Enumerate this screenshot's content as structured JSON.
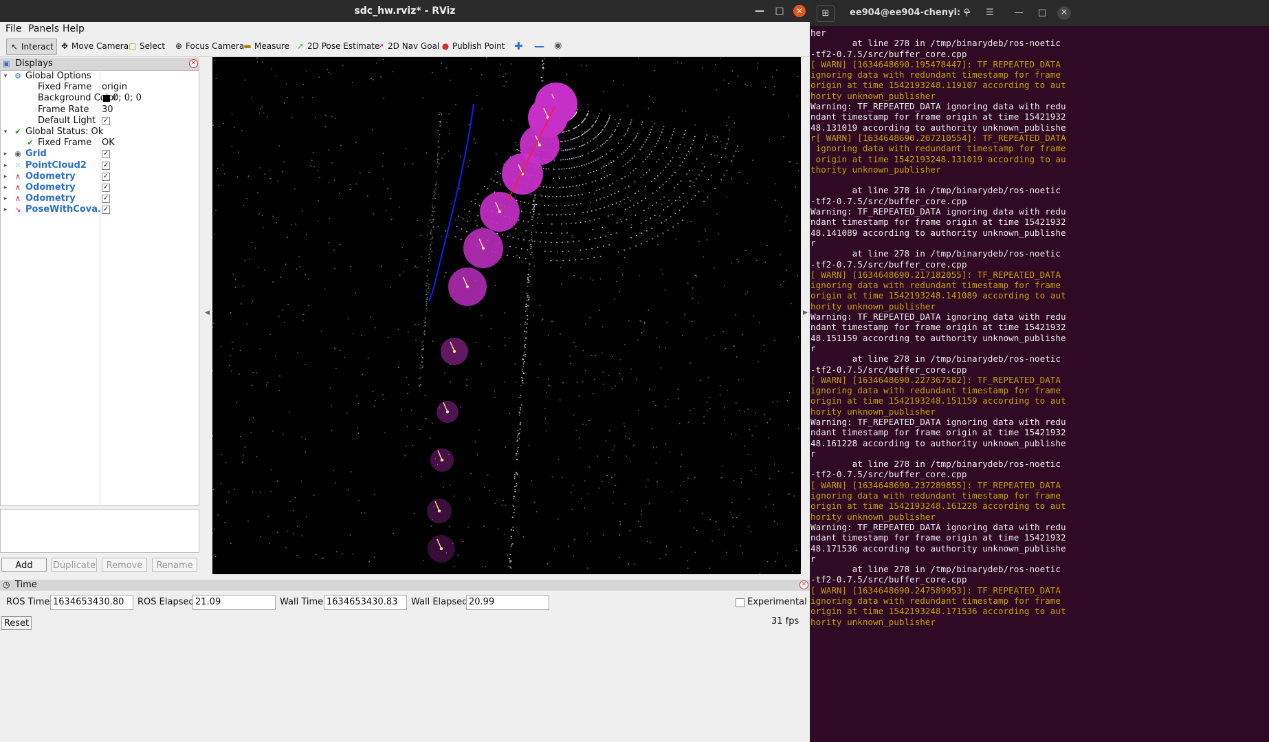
{
  "rviz": {
    "window_title": "sdc_hw.rviz* - RViz",
    "menu": [
      "File",
      "Panels",
      "Help"
    ],
    "tools": [
      "Interact",
      "Move Camera",
      "Select",
      "Focus Camera",
      "Measure",
      "2D Pose Estimate",
      "2D Nav Goal",
      "Publish Point"
    ],
    "displays_title": "Displays",
    "tree": [
      {
        "label": "Global Options",
        "value": "",
        "level": 0,
        "expanded": true,
        "icon": "gear-icon"
      },
      {
        "label": "Fixed Frame",
        "value": "origin",
        "level": 1
      },
      {
        "label": "Background Color",
        "value": "0; 0; 0",
        "level": 1,
        "swatch": "#000000"
      },
      {
        "label": "Frame Rate",
        "value": "30",
        "level": 1
      },
      {
        "label": "Default Light",
        "value": "",
        "level": 1,
        "checked": true
      },
      {
        "label": "Global Status: Ok",
        "value": "",
        "level": 0,
        "expanded": true,
        "icon": "check-icon"
      },
      {
        "label": "Fixed Frame",
        "value": "OK",
        "level": 1,
        "icon": "check-icon"
      },
      {
        "label": "Grid",
        "value": "",
        "level": 0,
        "display": true,
        "checked": true,
        "icon": "grid-icon"
      },
      {
        "label": "PointCloud2",
        "value": "",
        "level": 0,
        "display": true,
        "checked": true,
        "icon": "pointcloud-icon"
      },
      {
        "label": "Odometry",
        "value": "",
        "level": 0,
        "display": true,
        "checked": true,
        "icon": "odometry-icon"
      },
      {
        "label": "Odometry",
        "value": "",
        "level": 0,
        "display": true,
        "checked": true,
        "icon": "odometry-icon"
      },
      {
        "label": "Odometry",
        "value": "",
        "level": 0,
        "display": true,
        "checked": true,
        "icon": "odometry-icon"
      },
      {
        "label": "PoseWithCova...",
        "value": "",
        "level": 0,
        "display": true,
        "checked": true,
        "icon": "pose-icon"
      }
    ],
    "panel_buttons": [
      "Add",
      "Duplicate",
      "Remove",
      "Rename"
    ],
    "time": {
      "title": "Time",
      "ros_time_label": "ROS Time:",
      "ros_time": "1634653430.80",
      "ros_elapsed_label": "ROS Elapsed:",
      "ros_elapsed": "21.09",
      "wall_time_label": "Wall Time:",
      "wall_time": "1634653430.83",
      "wall_elapsed_label": "Wall Elapsed:",
      "wall_elapsed": "20.99",
      "experimental_label": "Experimental",
      "reset_label": "Reset",
      "fps": "31 fps"
    }
  },
  "terminal": {
    "title": "ee904@ee904-chenyi: ~",
    "lines": [
      {
        "t": "her",
        "w": false
      },
      {
        "t": "        at line 278 in /tmp/binarydeb/ros-noetic",
        "w": false
      },
      {
        "t": "-tf2-0.7.5/src/buffer_core.cpp",
        "w": false
      },
      {
        "t": "[ WARN] [1634648690.195478447]: TF_REPEATED_DATA",
        "w": true
      },
      {
        "t": "ignoring data with redundant timestamp for frame",
        "w": true
      },
      {
        "t": "origin at time 1542193248.119107 according to aut",
        "w": true
      },
      {
        "t": "hority unknown_publisher",
        "w": true
      },
      {
        "t": "Warning: TF_REPEATED_DATA ignoring data with redu",
        "w": false
      },
      {
        "t": "ndant timestamp for frame origin at time 15421932",
        "w": false
      },
      {
        "t": "48.131019 according to authority unknown_publishe",
        "w": false
      },
      {
        "t": "r[ WARN] [1634648690.207210554]: TF_REPEATED_DATA",
        "w": true
      },
      {
        "t": " ignoring data with redundant timestamp for frame",
        "w": true
      },
      {
        "t": " origin at time 1542193248.131019 according to au",
        "w": true
      },
      {
        "t": "thority unknown_publisher",
        "w": true
      },
      {
        "t": "",
        "w": false
      },
      {
        "t": "        at line 278 in /tmp/binarydeb/ros-noetic",
        "w": false
      },
      {
        "t": "-tf2-0.7.5/src/buffer_core.cpp",
        "w": false
      },
      {
        "t": "Warning: TF_REPEATED_DATA ignoring data with redu",
        "w": false
      },
      {
        "t": "ndant timestamp for frame origin at time 15421932",
        "w": false
      },
      {
        "t": "48.141089 according to authority unknown_publishe",
        "w": false
      },
      {
        "t": "r",
        "w": false
      },
      {
        "t": "        at line 278 in /tmp/binarydeb/ros-noetic",
        "w": false
      },
      {
        "t": "-tf2-0.7.5/src/buffer_core.cpp",
        "w": false
      },
      {
        "t": "[ WARN] [1634648690.217182055]: TF_REPEATED_DATA",
        "w": true
      },
      {
        "t": "ignoring data with redundant timestamp for frame",
        "w": true
      },
      {
        "t": "origin at time 1542193248.141089 according to aut",
        "w": true
      },
      {
        "t": "hority unknown_publisher",
        "w": true
      },
      {
        "t": "Warning: TF_REPEATED_DATA ignoring data with redu",
        "w": false
      },
      {
        "t": "ndant timestamp for frame origin at time 15421932",
        "w": false
      },
      {
        "t": "48.151159 according to authority unknown_publishe",
        "w": false
      },
      {
        "t": "r",
        "w": false
      },
      {
        "t": "        at line 278 in /tmp/binarydeb/ros-noetic",
        "w": false
      },
      {
        "t": "-tf2-0.7.5/src/buffer_core.cpp",
        "w": false
      },
      {
        "t": "[ WARN] [1634648690.227367582]: TF_REPEATED_DATA",
        "w": true
      },
      {
        "t": "ignoring data with redundant timestamp for frame",
        "w": true
      },
      {
        "t": "origin at time 1542193248.151159 according to aut",
        "w": true
      },
      {
        "t": "hority unknown_publisher",
        "w": true
      },
      {
        "t": "Warning: TF_REPEATED_DATA ignoring data with redu",
        "w": false
      },
      {
        "t": "ndant timestamp for frame origin at time 15421932",
        "w": false
      },
      {
        "t": "48.161228 according to authority unknown_publishe",
        "w": false
      },
      {
        "t": "r",
        "w": false
      },
      {
        "t": "        at line 278 in /tmp/binarydeb/ros-noetic",
        "w": false
      },
      {
        "t": "-tf2-0.7.5/src/buffer_core.cpp",
        "w": false
      },
      {
        "t": "[ WARN] [1634648690.237289855]: TF_REPEATED_DATA",
        "w": true
      },
      {
        "t": "ignoring data with redundant timestamp for frame",
        "w": true
      },
      {
        "t": "origin at time 1542193248.161228 according to aut",
        "w": true
      },
      {
        "t": "hority unknown_publisher",
        "w": true
      },
      {
        "t": "Warning: TF_REPEATED_DATA ignoring data with redu",
        "w": false
      },
      {
        "t": "ndant timestamp for frame origin at time 15421932",
        "w": false
      },
      {
        "t": "48.171536 according to authority unknown_publishe",
        "w": false
      },
      {
        "t": "r",
        "w": false
      },
      {
        "t": "        at line 278 in /tmp/binarydeb/ros-noetic",
        "w": false
      },
      {
        "t": "-tf2-0.7.5/src/buffer_core.cpp",
        "w": false
      },
      {
        "t": "[ WARN] [1634648690.247589953]: TF_REPEATED_DATA",
        "w": true
      },
      {
        "t": "ignoring data with redundant timestamp for frame",
        "w": true
      },
      {
        "t": "origin at time 1542193248.171536 according to aut",
        "w": true
      },
      {
        "t": "hority unknown_publisher",
        "w": true
      }
    ]
  },
  "colors": {
    "viewport_bg": "#000000",
    "covariance": "#c62fc8",
    "path_blue": "#1a1aff",
    "path_red": "#ff2020",
    "terminal_bg": "#300a24",
    "warn_text": "#c4a000"
  }
}
